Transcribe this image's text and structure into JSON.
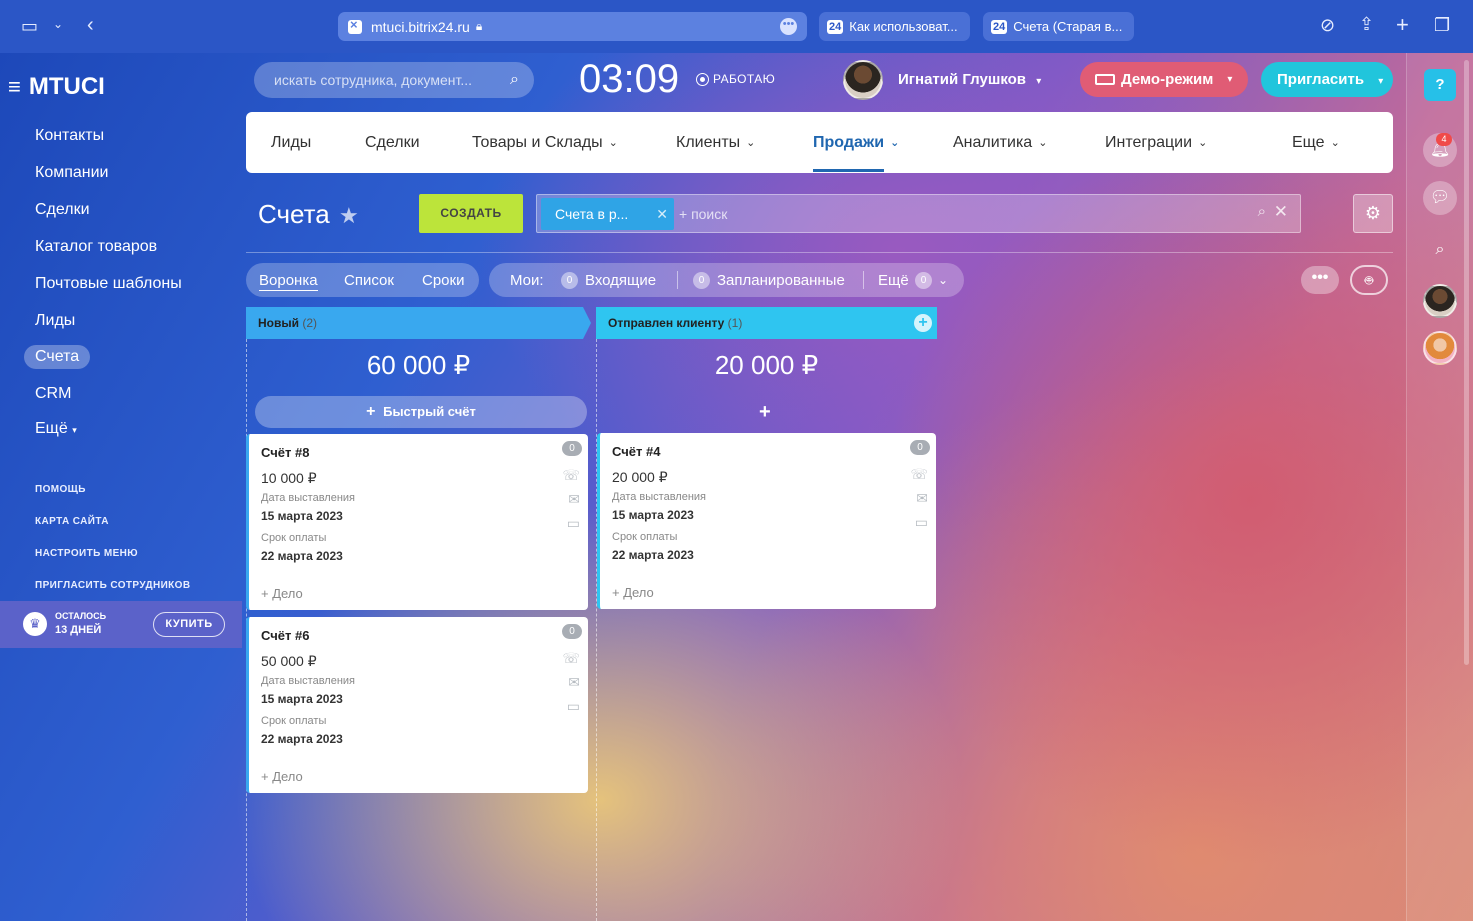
{
  "browser": {
    "url": "mtuci.bitrix24.ru",
    "tabs": [
      {
        "label": "Как использоват..."
      },
      {
        "label": "Счета (Старая в..."
      }
    ]
  },
  "sidebar": {
    "logo": "MTUCI",
    "items": [
      {
        "label": "Контакты"
      },
      {
        "label": "Компании"
      },
      {
        "label": "Сделки"
      },
      {
        "label": "Каталог товаров"
      },
      {
        "label": "Почтовые шаблоны"
      },
      {
        "label": "Лиды"
      },
      {
        "label": "Счета"
      },
      {
        "label": "CRM"
      },
      {
        "label": "Ещё"
      }
    ],
    "links": [
      {
        "label": "ПОМОЩЬ"
      },
      {
        "label": "КАРТА САЙТА"
      },
      {
        "label": "НАСТРОИТЬ МЕНЮ"
      },
      {
        "label": "ПРИГЛАСИТЬ СОТРУДНИКОВ"
      }
    ],
    "trial": {
      "line1": "ОСТАЛОСЬ",
      "line2": "13 ДНЕЙ",
      "buy": "КУПИТЬ"
    }
  },
  "header": {
    "search_placeholder": "искать сотрудника, документ...",
    "time": "03:09",
    "status": "РАБОТАЮ",
    "user": "Игнатий Глушков",
    "demo": "Демо-режим",
    "invite": "Пригласить"
  },
  "nav": {
    "items": [
      {
        "label": "Лиды"
      },
      {
        "label": "Сделки"
      },
      {
        "label": "Товары и Склады"
      },
      {
        "label": "Клиенты"
      },
      {
        "label": "Продажи"
      },
      {
        "label": "Аналитика"
      },
      {
        "label": "Интеграции"
      },
      {
        "label": "Еще"
      }
    ]
  },
  "page": {
    "title": "Счета",
    "create": "СОЗДАТЬ",
    "filter_chip": "Счета в р...",
    "filter_placeholder": "+ поиск"
  },
  "views": {
    "items": [
      {
        "label": "Воронка"
      },
      {
        "label": "Список"
      },
      {
        "label": "Сроки"
      }
    ],
    "my": "Мои:",
    "incoming_count": "0",
    "incoming": "Входящие",
    "planned_count": "0",
    "planned": "Запланированные",
    "more": "Ещё",
    "more_count": "0"
  },
  "columns": [
    {
      "title": "Новый",
      "count": "(2)",
      "sum": "60 000 ₽",
      "quick": "Быстрый счёт",
      "color": "#39a8ef",
      "cards": [
        {
          "title": "Счёт #8",
          "amount": "10 000 ₽",
          "date_label": "Дата выставления",
          "date": "15 марта 2023",
          "due_label": "Срок оплаты",
          "due": "22 марта 2023",
          "add": "+ Дело",
          "badge": "0"
        },
        {
          "title": "Счёт #6",
          "amount": "50 000 ₽",
          "date_label": "Дата выставления",
          "date": "15 марта 2023",
          "due_label": "Срок оплаты",
          "due": "22 марта 2023",
          "add": "+ Дело",
          "badge": "0"
        }
      ]
    },
    {
      "title": "Отправлен клиенту",
      "count": "(1)",
      "sum": "20 000 ₽",
      "color": "#2fc5f0",
      "cards": [
        {
          "title": "Счёт #4",
          "amount": "20 000 ₽",
          "date_label": "Дата выставления",
          "date": "15 марта 2023",
          "due_label": "Срок оплаты",
          "due": "22 марта 2023",
          "add": "+ Дело",
          "badge": "0"
        }
      ]
    }
  ],
  "rail": {
    "notifications": "4"
  }
}
